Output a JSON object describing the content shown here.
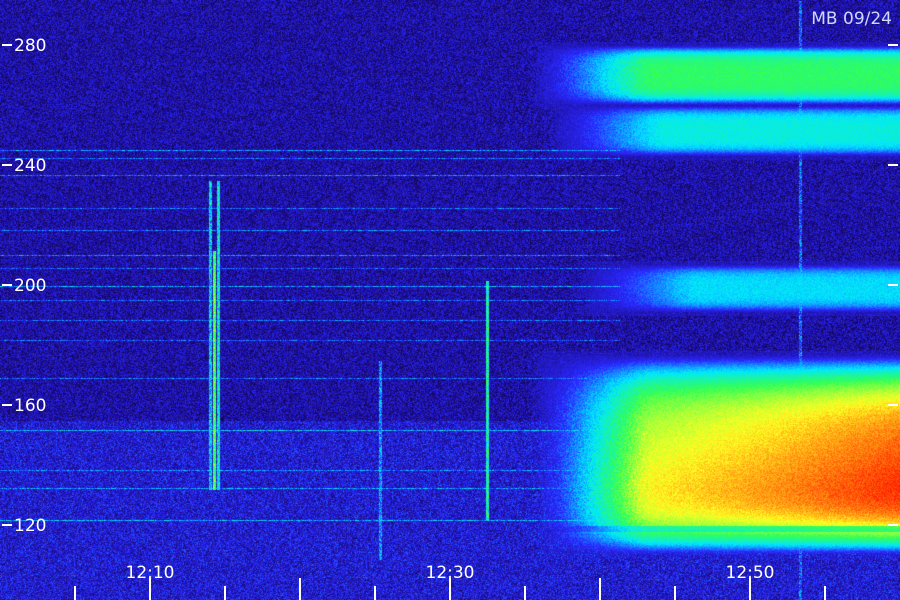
{
  "chart_data": {
    "type": "heatmap",
    "title": "",
    "corner_label": "MB 09/24",
    "y_axis": {
      "ylim": [
        110,
        295
      ],
      "ticks": [
        120,
        160,
        200,
        240,
        280
      ],
      "tick_labels": [
        "120",
        "160",
        "200",
        "240",
        "280"
      ]
    },
    "x_axis": {
      "time_range": [
        "12:00",
        "12:60"
      ],
      "tick_labels": [
        "12:10",
        "12:30",
        "12:50"
      ],
      "tick_positions": [
        "12:10",
        "12:30",
        "12:50"
      ],
      "major_tick_interval_min": 5
    },
    "colorscale": [
      "#04021c",
      "#1a0a80",
      "#2a28ff",
      "#00e8ff",
      "#33ff55",
      "#ffff22",
      "#ff1e00"
    ],
    "features": [
      {
        "name": "upper band",
        "time": [
          "12:41",
          "12:60"
        ],
        "freq": [
          262,
          278
        ],
        "intensity": 0.55
      },
      {
        "name": "upper band 2",
        "time": [
          "12:42",
          "12:60"
        ],
        "freq": [
          245,
          258
        ],
        "intensity": 0.4
      },
      {
        "name": "mid band",
        "time": [
          "12:44",
          "12:60"
        ],
        "freq": [
          193,
          205
        ],
        "intensity": 0.35
      },
      {
        "name": "main emission",
        "time": [
          "12:41",
          "12:60"
        ],
        "freq": [
          112,
          175
        ],
        "intensity": 0.95
      }
    ]
  }
}
